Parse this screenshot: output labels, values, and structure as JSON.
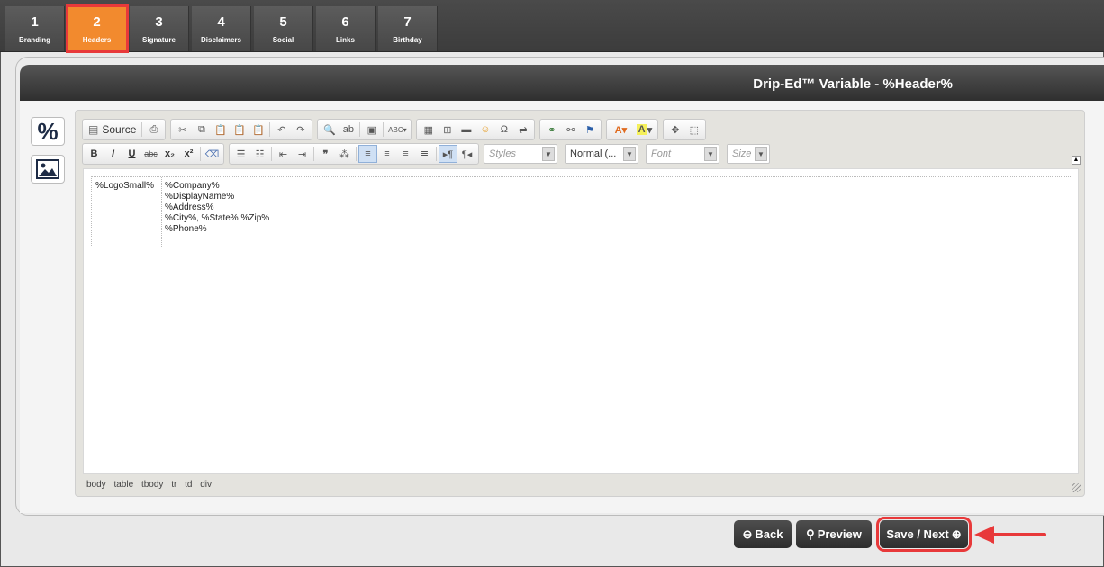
{
  "tabs": [
    {
      "num": "1",
      "label": "Branding"
    },
    {
      "num": "2",
      "label": "Headers"
    },
    {
      "num": "3",
      "label": "Signature"
    },
    {
      "num": "4",
      "label": "Disclaimers"
    },
    {
      "num": "5",
      "label": "Social"
    },
    {
      "num": "6",
      "label": "Links"
    },
    {
      "num": "7",
      "label": "Birthday"
    }
  ],
  "panel": {
    "title": "Drip-Ed™ Variable - %Header%"
  },
  "sidebar": {
    "percent_symbol": "%"
  },
  "toolbar": {
    "source_label": "Source",
    "styles_placeholder": "Styles",
    "format_value": "Normal (...",
    "font_placeholder": "Font",
    "size_placeholder": "Size"
  },
  "editor_content": {
    "logo_cell": "%LogoSmall%",
    "info_lines": [
      "%Company%",
      "%DisplayName%",
      "%Address%",
      "%City%, %State% %Zip%",
      "%Phone%"
    ]
  },
  "path_bar": [
    "body",
    "table",
    "tbody",
    "tr",
    "td",
    "div"
  ],
  "footer": {
    "back_label": "Back",
    "preview_label": "Preview",
    "save_label": "Save / Next"
  },
  "colors": {
    "active_tab": "#f28a2e",
    "highlight": "#e8393a"
  }
}
